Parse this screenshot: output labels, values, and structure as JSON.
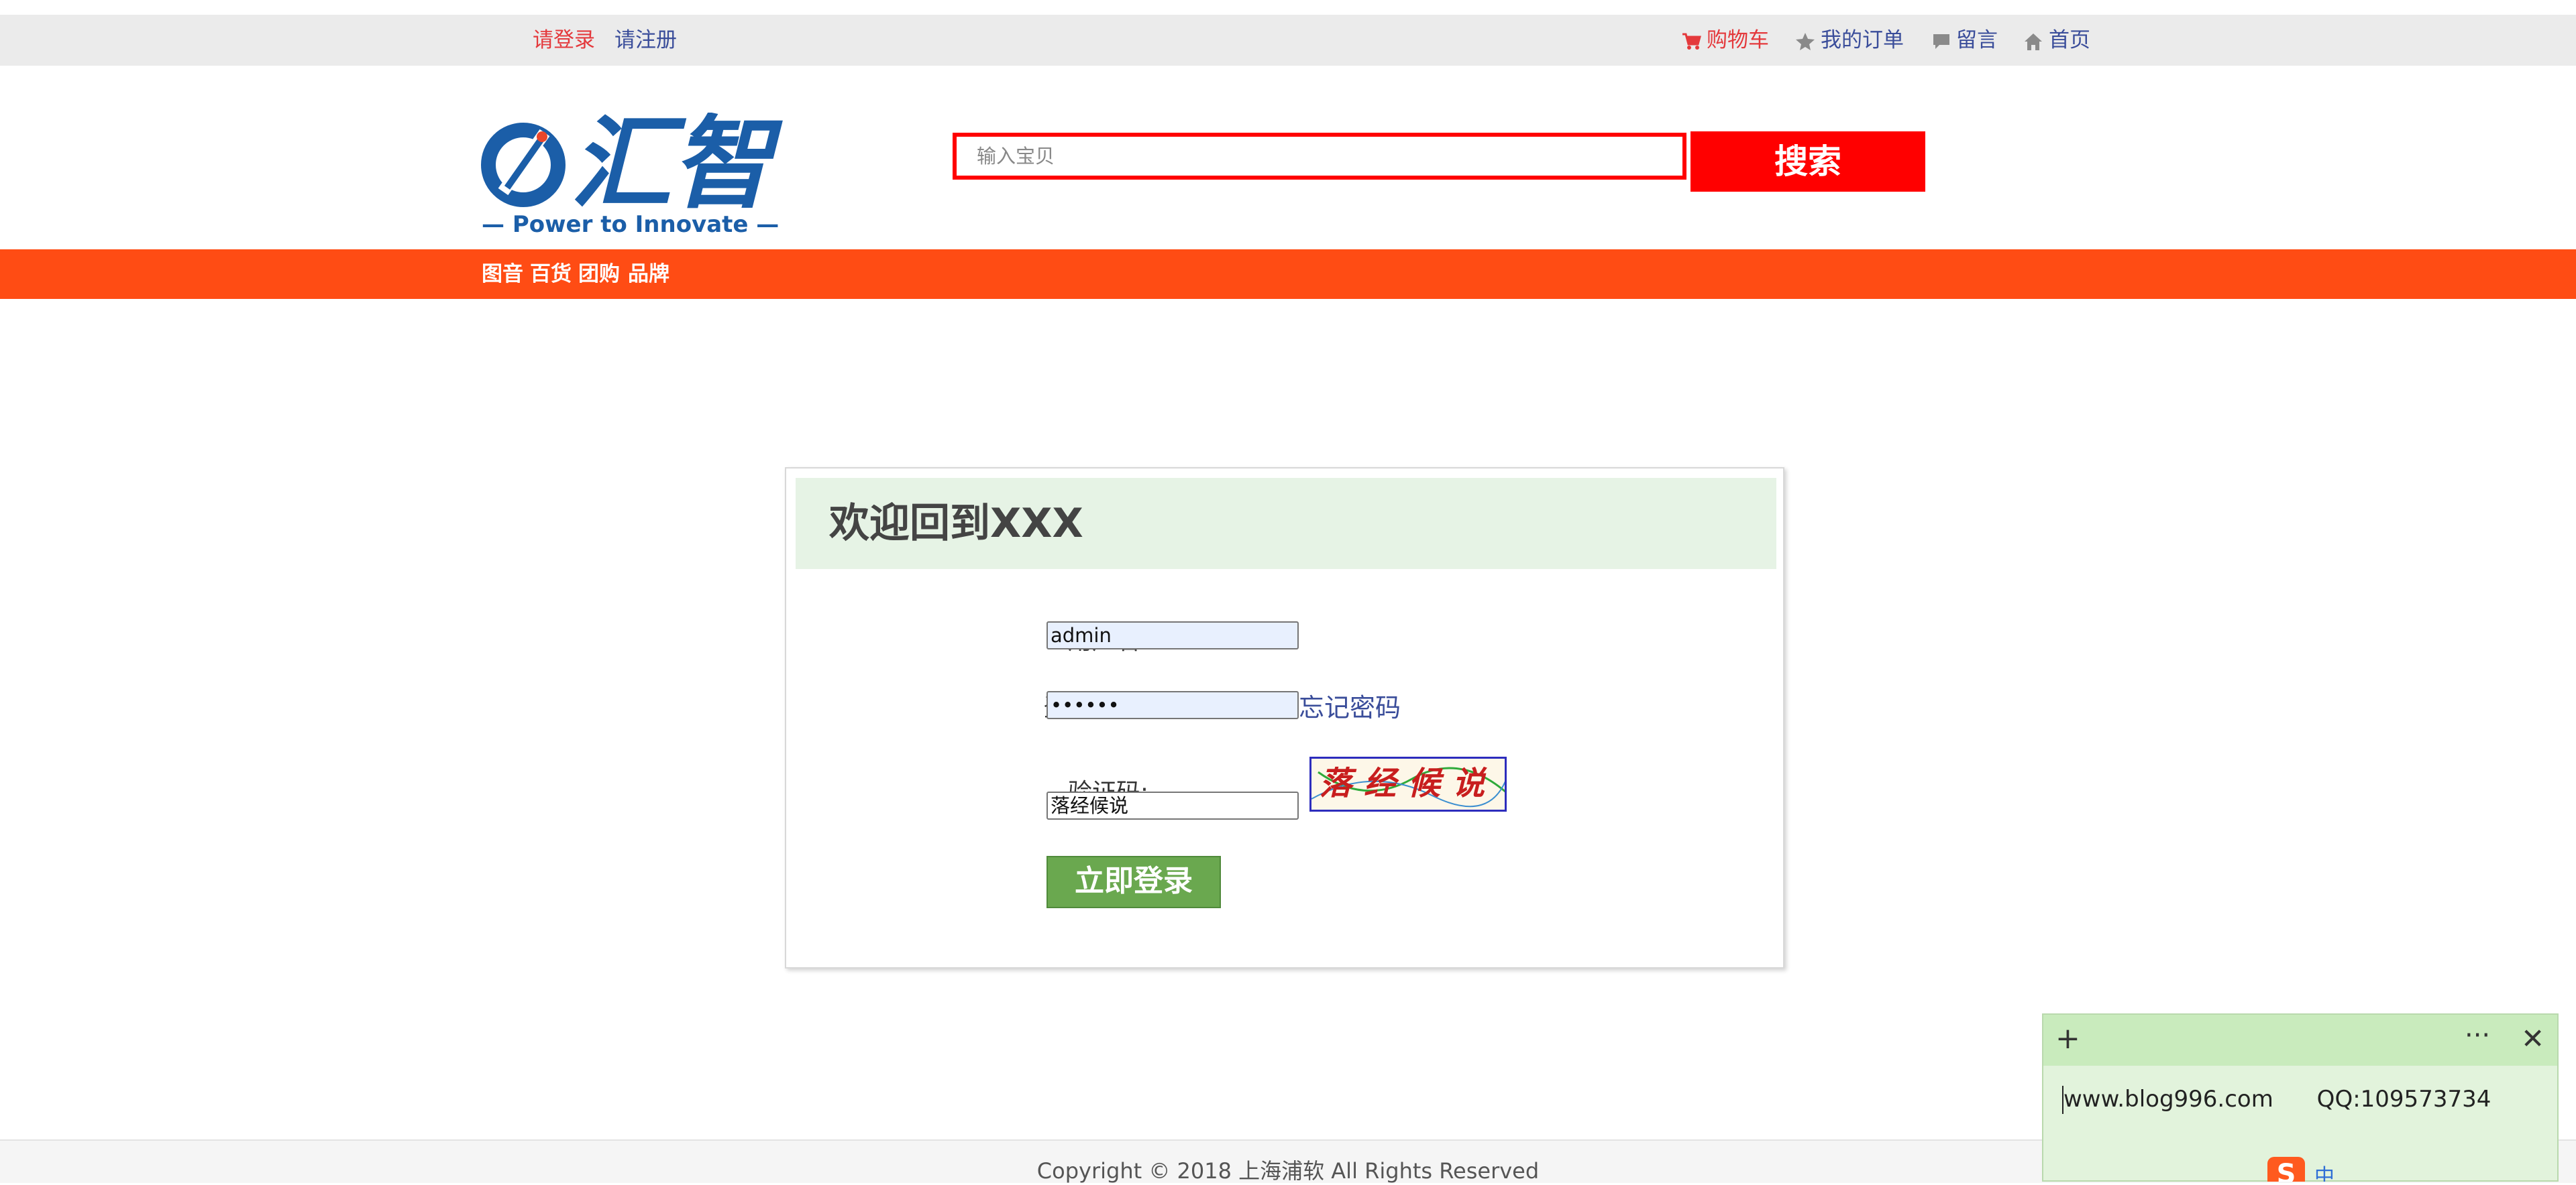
{
  "topbar": {
    "login_link": "请登录",
    "register_link": "请注册",
    "cart": "购物车",
    "orders": "我的订单",
    "message": "留言",
    "home": "首页"
  },
  "logo": {
    "brand": "汇智",
    "slogan": "— Power to Innovate —"
  },
  "search": {
    "placeholder": "输入宝贝",
    "button": "搜索"
  },
  "nav": {
    "items": [
      "图音",
      "百货",
      "团购",
      "品牌"
    ]
  },
  "login": {
    "title": "欢迎回到XXX",
    "username_label": "用户名:",
    "username_value": "admin",
    "password_label": "登录密码:",
    "password_value": "••••••",
    "forgot": "忘记密码",
    "captcha_label": "验证码:",
    "captcha_value": "落经候说",
    "captcha_image_text": "落经候说",
    "submit": "立即登录"
  },
  "footer": {
    "copyright": "Copyright © 2018 上海浦软 All Rights Reserved"
  },
  "sticky_note": {
    "text": "www.blog996.com      QQ:109573734",
    "more": "···",
    "plus": "+",
    "close": "✕"
  },
  "ime": {
    "logo": "S",
    "mode": "中"
  },
  "colors": {
    "accent_red": "#ff0000",
    "nav_orange": "#ff4c14",
    "login_green": "#6aa84f",
    "link_blue": "#3a4d9a",
    "topbar_gray": "#ebebeb"
  }
}
